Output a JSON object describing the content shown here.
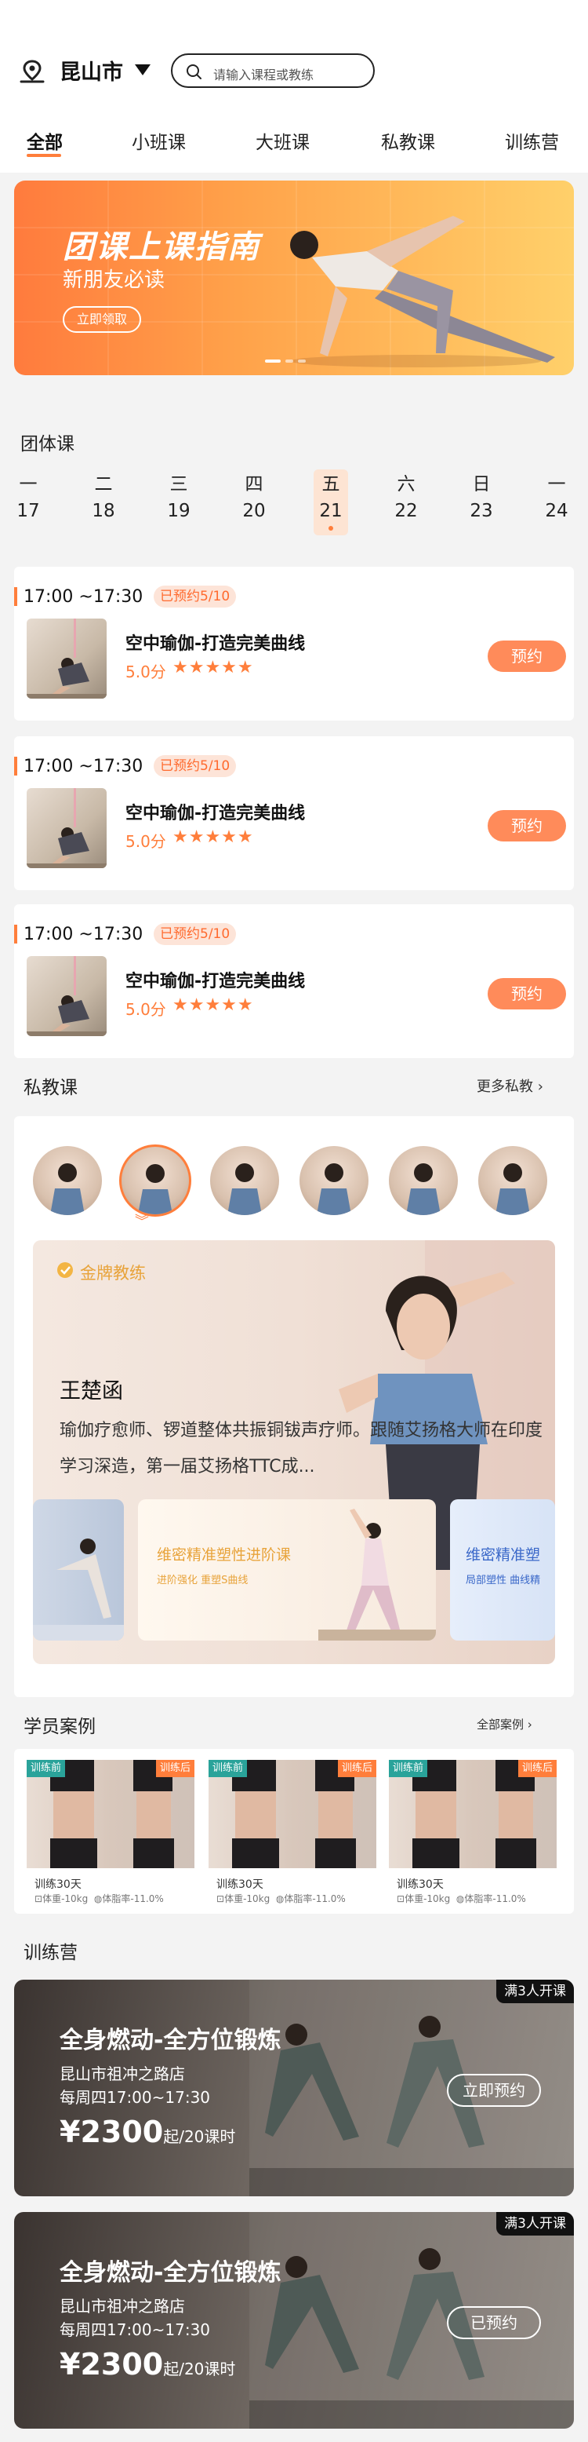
{
  "header": {
    "city": "昆山市",
    "search_placeholder": "请输入课程或教练"
  },
  "tabs": [
    {
      "label": "全部",
      "active": true
    },
    {
      "label": "小班课",
      "active": false
    },
    {
      "label": "大班课",
      "active": false
    },
    {
      "label": "私教课",
      "active": false
    },
    {
      "label": "训练营",
      "active": false
    }
  ],
  "banner": {
    "title": "团课上课指南",
    "subtitle": "新朋友必读",
    "button": "立即领取",
    "gradient_colors": [
      "#ff7b3d",
      "#ffd06a"
    ]
  },
  "group_course": {
    "title": "团体课",
    "days": [
      {
        "weekday": "一",
        "date": "17"
      },
      {
        "weekday": "二",
        "date": "18"
      },
      {
        "weekday": "三",
        "date": "19"
      },
      {
        "weekday": "四",
        "date": "20"
      },
      {
        "weekday": "五",
        "date": "21",
        "active": true
      },
      {
        "weekday": "六",
        "date": "22"
      },
      {
        "weekday": "日",
        "date": "23"
      },
      {
        "weekday": "一",
        "date": "24"
      }
    ],
    "courses": [
      {
        "time": "17:00 ~17:30",
        "badge": "已预约5/10",
        "name": "空中瑜伽-打造完美曲线",
        "score": "5.0分",
        "stars": "★★★★★",
        "rating": 5,
        "button": "预约"
      },
      {
        "time": "17:00 ~17:30",
        "badge": "已预约5/10",
        "name": "空中瑜伽-打造完美曲线",
        "score": "5.0分",
        "stars": "★★★★★",
        "rating": 5,
        "button": "预约"
      },
      {
        "time": "17:00 ~17:30",
        "badge": "已预约5/10",
        "name": "空中瑜伽-打造完美曲线",
        "score": "5.0分",
        "stars": "★★★★★",
        "rating": 5,
        "button": "预约"
      }
    ]
  },
  "private_coach": {
    "title": "私教课",
    "more": "更多私教 ›",
    "gold_badge": "金牌教练",
    "coach_name": "王楚函",
    "coach_desc": "瑜伽疗愈师、锣道整体共振铜钹声疗师。跟随艾扬格大师在印度学习深造，第一届艾扬格TTC成...",
    "mini_cards": [
      {
        "title": "维密精准塑性进阶课",
        "sub": "进阶强化 重塑S曲线"
      },
      {
        "title": "维密精准塑",
        "sub": "局部塑性 曲线精"
      }
    ]
  },
  "cases": {
    "title": "学员案例",
    "more": "全部案例 ›",
    "items": [
      {
        "before": "训练前",
        "after": "训练后",
        "days": "训练30天",
        "weight": "体重-10kg",
        "fat": "体脂率-11.0%"
      },
      {
        "before": "训练前",
        "after": "训练后",
        "days": "训练30天",
        "weight": "体重-10kg",
        "fat": "体脂率-11.0%"
      },
      {
        "before": "训练前",
        "after": "训练后",
        "days": "训练30天",
        "weight": "体重-10kg",
        "fat": "体脂率-11.0%"
      }
    ]
  },
  "camp": {
    "title": "训练营",
    "items": [
      {
        "tag": "满3人开课",
        "name": "全身燃动-全方位锻炼",
        "address": "昆山市祖冲之路店",
        "schedule": "每周四17:00~17:30",
        "price": "¥2300",
        "unit": "起/20课时",
        "button": "立即预约"
      },
      {
        "tag": "满3人开课",
        "name": "全身燃动-全方位锻炼",
        "address": "昆山市祖冲之路店",
        "schedule": "每周四17:00~17:30",
        "price": "¥2300",
        "unit": "起/20课时",
        "button": "已预约"
      }
    ]
  },
  "colors": {
    "accent": "#ff7e3b",
    "button": "#ff8b5a",
    "badge_bg": "#fde4d8",
    "gold": "#e8a33a"
  }
}
